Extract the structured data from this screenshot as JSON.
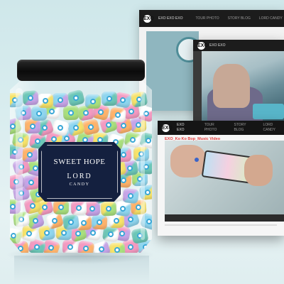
{
  "back_screen": {
    "nav_logo": "EXO",
    "nav_brand": "EXO EXO EXO",
    "menu": [
      "TOUR PHOTO",
      "STORY BLOG",
      "LORD CANDY"
    ]
  },
  "mid_screen": {
    "nav_brand": "EXO EXO"
  },
  "front_screen": {
    "nav_brand": "EXO EXO",
    "menu": [
      "TOUR PHOTO",
      "STORY BLOG",
      "LORD CANDY"
    ],
    "video_title": "EXO_Ko Ko Bop_Music Video"
  },
  "jar_label": {
    "line1": "SWEET HOPE",
    "line2": "LORD",
    "line3": "CANDY"
  },
  "colors": {
    "label_navy": "#14203f",
    "title_red": "#e23b3b",
    "lid_black": "#0b0b0b"
  }
}
